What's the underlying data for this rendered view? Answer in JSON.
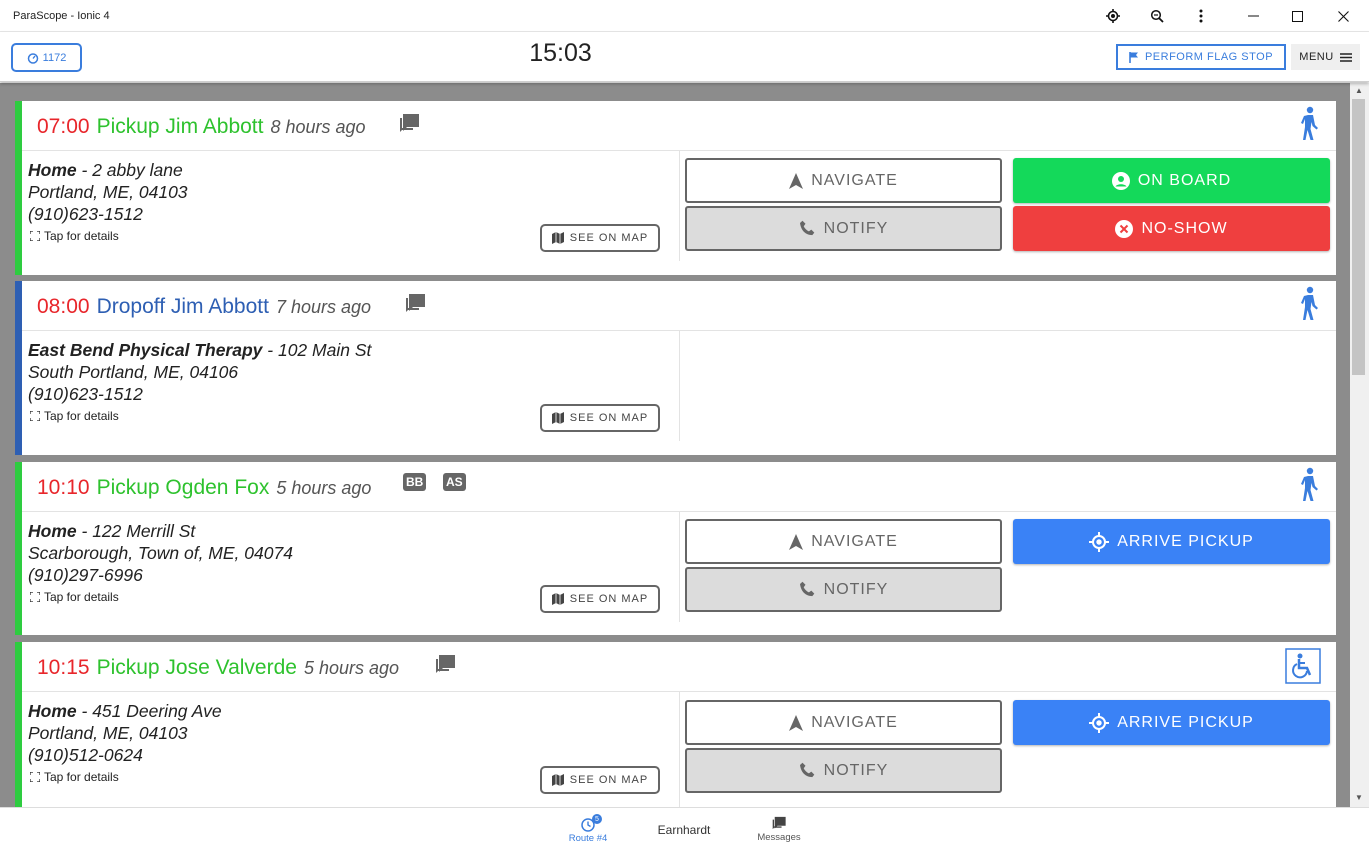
{
  "window": {
    "title": "ParaScope - Ionic 4"
  },
  "header": {
    "vehicle_number": "1172",
    "clock": "15:03",
    "flag_stop_label": "PERFORM FLAG STOP",
    "menu_label": "MENU"
  },
  "colors": {
    "pickup_accent": "#2ecc40",
    "dropoff_accent": "#2e5fb3",
    "time_red": "#e8262b",
    "on_board_green": "#14d95a",
    "no_show_red": "#ef3f3f",
    "arrive_blue": "#3a82f6"
  },
  "common": {
    "tap_for_details": "Tap for details",
    "see_on_map": "SEE ON MAP",
    "navigate": "NAVIGATE",
    "notify": "NOTIFY"
  },
  "stops": [
    {
      "time": "07:00",
      "label": "Pickup Jim Abbott",
      "type": "pickup",
      "ago": "8 hours ago",
      "icons": [
        "chat-icon"
      ],
      "mode_icon": "walking-person-icon",
      "address_name": "Home",
      "address_sep": " - ",
      "address_street": "2 abby lane",
      "address_city": "Portland, ME, 04103",
      "phone": "(910)623-1512",
      "primary_action": "ON BOARD",
      "secondary_action": "NO-SHOW"
    },
    {
      "time": "08:00",
      "label": "Dropoff Jim Abbott",
      "type": "dropoff",
      "ago": "7 hours ago",
      "icons": [
        "chat-icon"
      ],
      "mode_icon": "walking-person-icon",
      "address_name": "East Bend Physical Therapy",
      "address_sep": " - ",
      "address_street": "102 Main St",
      "address_city": "South Portland, ME, 04106",
      "phone": "(910)623-1512"
    },
    {
      "time": "10:10",
      "label": "Pickup Ogden Fox",
      "type": "pickup",
      "ago": "5 hours ago",
      "badges": [
        "BB",
        "AS"
      ],
      "mode_icon": "walking-person-icon",
      "address_name": "Home",
      "address_sep": " - ",
      "address_street": "122 Merrill St",
      "address_city": "Scarborough, Town of, ME, 04074",
      "phone": "(910)297-6996",
      "primary_action": "ARRIVE PICKUP"
    },
    {
      "time": "10:15",
      "label": "Pickup Jose Valverde",
      "type": "pickup",
      "ago": "5 hours ago",
      "icons": [
        "chat-icon"
      ],
      "mode_icon": "wheelchair-icon",
      "address_name": "Home",
      "address_sep": " - ",
      "address_street": "451 Deering Ave",
      "address_city": "Portland, ME, 04103",
      "phone": "(910)512-0624",
      "primary_action": "ARRIVE PICKUP"
    }
  ],
  "tabs": [
    {
      "label": "Route #4",
      "icon": "clock-icon",
      "badge": "5",
      "active": true
    },
    {
      "label": "Earnhardt",
      "active": false
    },
    {
      "label": "Messages",
      "icon": "chat-icon",
      "active": false
    }
  ]
}
